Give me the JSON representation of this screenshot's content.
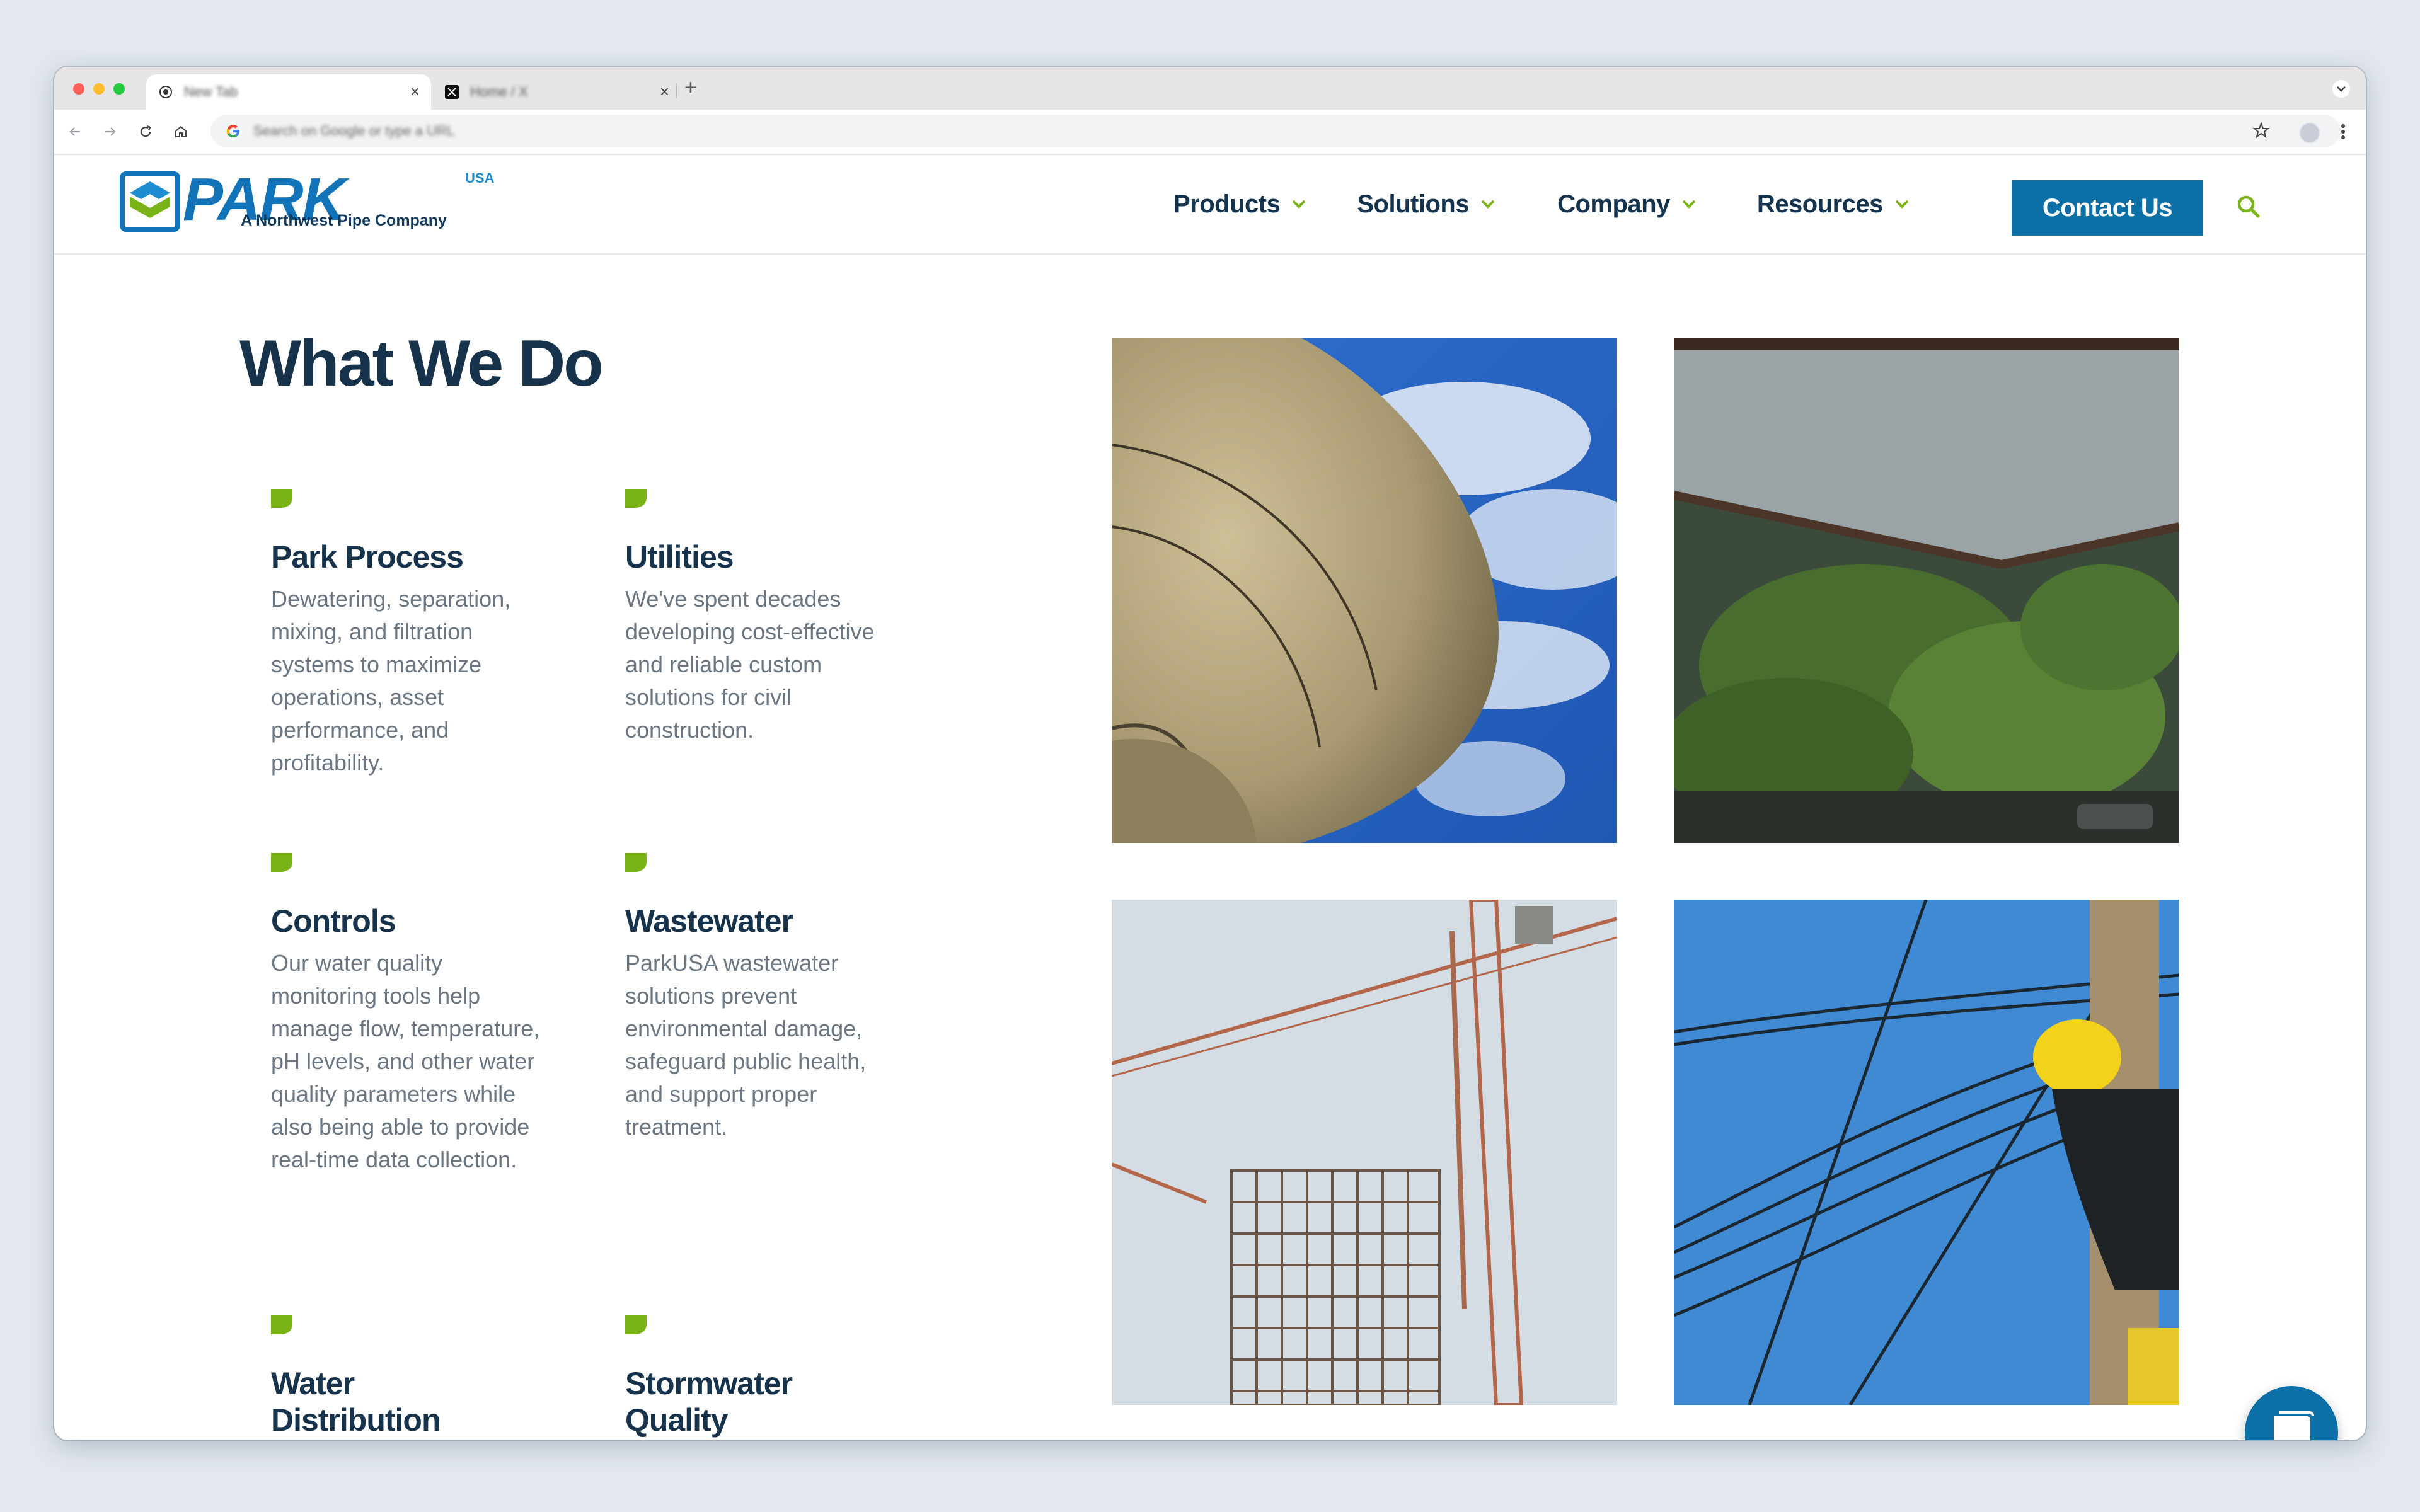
{
  "browser": {
    "tabs": [
      {
        "title": "New Tab",
        "active": true
      },
      {
        "title": "Home / X",
        "active": false
      }
    ],
    "omnibox_placeholder": "Search on Google or type a URL"
  },
  "site": {
    "logo": {
      "word": "PARK",
      "usa": "USA",
      "tagline": "A Northwest Pipe Company"
    },
    "nav": [
      {
        "label": "Products"
      },
      {
        "label": "Solutions"
      },
      {
        "label": "Company"
      },
      {
        "label": "Resources"
      }
    ],
    "contact_label": "Contact Us",
    "colors": {
      "brand_blue": "#0c6fa6",
      "navy": "#16334b",
      "accent_green": "#7ab317"
    }
  },
  "main": {
    "heading": "What We Do",
    "services": [
      {
        "title": "Park Process",
        "text": "Dewatering, separation, mixing, and filtration systems to maximize operations, asset performance, and profitability."
      },
      {
        "title": "Utilities",
        "text": "We've spent decades developing cost-effective and reliable custom solutions for civil construction."
      },
      {
        "title": "Controls",
        "text": "Our water quality monitoring tools help manage flow, temperature, pH levels, and other water quality parameters while also being able to provide real-time data collection."
      },
      {
        "title": "Wastewater",
        "text": "ParkUSA wastewater solutions prevent environmental damage, safeguard public health, and support proper treatment."
      },
      {
        "title": "Water Distribution",
        "text": ""
      },
      {
        "title": "Stormwater Quality",
        "text": ""
      }
    ],
    "images": [
      {
        "subject": "water-tower"
      },
      {
        "subject": "rain-on-glass-canopy"
      },
      {
        "subject": "construction-cranes"
      },
      {
        "subject": "utility-lineworker"
      }
    ]
  }
}
